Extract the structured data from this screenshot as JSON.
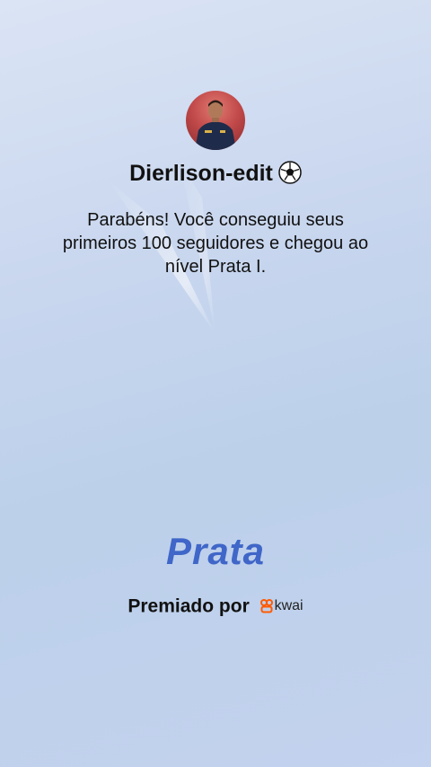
{
  "profile": {
    "username": "Dierlison-edit",
    "avatar_description_icon": "user-avatar"
  },
  "congrats": {
    "message": "Parabéns! Você conseguiu seus primeiros 100 seguidores e chegou ao nível Prata I."
  },
  "tier": {
    "name": "Prata",
    "color": "#3f66c8"
  },
  "awarded": {
    "label": "Premiado por",
    "brand": "kwai",
    "brand_color": "#ff5a00"
  },
  "colors": {
    "background_top": "#dbe4f5",
    "background_bottom": "#c3d2ee",
    "text": "#111111"
  }
}
